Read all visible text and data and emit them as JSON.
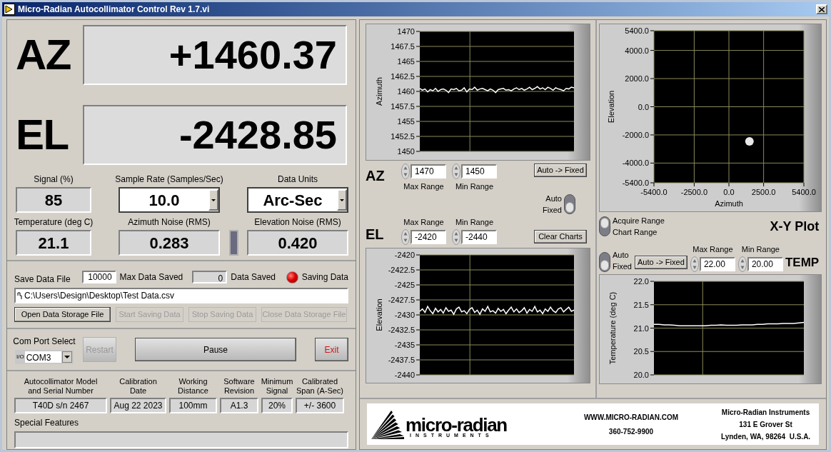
{
  "window": {
    "title": "Micro-Radian Autocollimator Control Rev 1.7.vi"
  },
  "readouts": [
    {
      "label": "AZ",
      "value": "+1460.37"
    },
    {
      "label": "EL",
      "value": "-2428.85"
    }
  ],
  "indicators": [
    {
      "label": "Signal (%)",
      "value": "85",
      "kind": "display"
    },
    {
      "label": "Sample Rate (Samples/Sec)",
      "value": "10.0",
      "kind": "dropdown"
    },
    {
      "label": "Data Units",
      "value": "Arc-Sec",
      "kind": "dropdown"
    },
    {
      "label": "Temperature (deg C)",
      "value": "21.1",
      "kind": "display"
    },
    {
      "label": "Azimuth Noise (RMS)",
      "value": "0.283",
      "kind": "display"
    },
    {
      "label": "Elevation Noise (RMS)",
      "value": "0.420",
      "kind": "display"
    }
  ],
  "save_data": {
    "title": "Save Data File",
    "max_saved": {
      "value": "10000",
      "label": "Max Data Saved"
    },
    "data_saved": {
      "value": "0",
      "label": "Data Saved"
    },
    "saving_led": {
      "label": "Saving Data",
      "on": true
    },
    "path": "C:\\Users\\Design\\Desktop\\Test Data.csv",
    "buttons": [
      {
        "label": "Open Data Storage File",
        "disabled": false
      },
      {
        "label": "Start Saving Data",
        "disabled": true
      },
      {
        "label": "Stop Saving Data",
        "disabled": true
      },
      {
        "label": "Close Data Storage File",
        "disabled": true
      }
    ]
  },
  "com_port": {
    "label": "Com Port Select",
    "io_symbol": "I/O",
    "value": "COM3"
  },
  "control_buttons": [
    {
      "label": "Restart",
      "kind": "small",
      "disabled": true
    },
    {
      "label": "Pause",
      "kind": "wide",
      "disabled": false
    },
    {
      "label": "Exit",
      "kind": "exit",
      "disabled": false
    }
  ],
  "info": {
    "columns": [
      {
        "label": "Autocollimator Model\nand Serial Number",
        "value": "T40D s/n 2467"
      },
      {
        "label": "Calibration\nDate",
        "value": "Aug 22 2023"
      },
      {
        "label": "Working\nDistance",
        "value": "100mm"
      },
      {
        "label": "Software\nRevision",
        "value": "A1.3"
      },
      {
        "label": "Minimum\nSignal",
        "value": "20%"
      },
      {
        "label": "Calibrated\nSpan (A-Sec)",
        "value": "+/- 3600"
      }
    ],
    "special_features": {
      "label": "Special Features"
    }
  },
  "az": {
    "label": "AZ",
    "max_range": {
      "label": "Max Range",
      "value": "1470"
    },
    "min_range": {
      "label": "Min Range",
      "value": "1450"
    },
    "button": "Auto -> Fixed",
    "chart_data": {
      "type": "line",
      "grid": true,
      "ylabel": "Azimuth",
      "ylim": [
        1450,
        1470
      ],
      "yticks": [
        1470,
        1467.5,
        1465,
        1462.5,
        1460,
        1457.5,
        1455,
        1452.5,
        1450
      ],
      "series": [
        {
          "color": "#ffffff",
          "values": [
            1460.5,
            1460.2,
            1460.4,
            1459.9,
            1460.3,
            1460.1,
            1460.5,
            1460.0,
            1460.3,
            1460.4,
            1460.2,
            1459.8,
            1460.4,
            1460.3,
            1460.5,
            1460.1,
            1460.2,
            1460.6,
            1459.9,
            1460.4,
            1460.3,
            1460.7,
            1460.2,
            1460.4,
            1460.5,
            1460.3,
            1460.1,
            1460.4,
            1460.2,
            1459.8,
            1460.3,
            1460.4,
            1460.5,
            1460.2,
            1460.3,
            1460.1,
            1460.4,
            1460.6,
            1460.3,
            1460.5,
            1460.2,
            1460.4,
            1460.7,
            1460.3,
            1460.5,
            1460.8,
            1460.4,
            1460.6,
            1460.3,
            1460.7,
            1460.5,
            1460.2,
            1460.6,
            1460.4,
            1460.3,
            1460.1,
            1460.5,
            1460.4,
            1460.7,
            1460.6
          ]
        }
      ]
    }
  },
  "auto_toggle": {
    "labels": [
      "Auto",
      "Fixed"
    ],
    "auto": false
  },
  "el": {
    "label": "EL",
    "max_range": {
      "label": "Max Range",
      "value": "-2420"
    },
    "min_range": {
      "label": "Min Range",
      "value": "-2440"
    },
    "button": "Clear Charts",
    "chart_data": {
      "type": "line",
      "grid": true,
      "ylabel": "Elevation",
      "ylim": [
        -2440,
        -2420
      ],
      "yticks": [
        -2420,
        -2422.5,
        -2425,
        -2427.5,
        -2430,
        -2432.5,
        -2435,
        -2437.5,
        -2440
      ],
      "series": [
        {
          "color": "#ffffff",
          "values": [
            -2429.4,
            -2429.0,
            -2429.6,
            -2428.6,
            -2429.3,
            -2429.8,
            -2428.9,
            -2429.5,
            -2429.1,
            -2429.7,
            -2428.8,
            -2429.4,
            -2429.2,
            -2429.9,
            -2429.0,
            -2428.7,
            -2429.5,
            -2429.3,
            -2429.8,
            -2429.1,
            -2428.8,
            -2429.6,
            -2429.2,
            -2429.9,
            -2429.0,
            -2429.4,
            -2428.6,
            -2429.5,
            -2429.3,
            -2429.7,
            -2428.9,
            -2429.4,
            -2429.1,
            -2429.8,
            -2429.2,
            -2428.7,
            -2429.5,
            -2429.0,
            -2429.6,
            -2429.3,
            -2428.8,
            -2429.7,
            -2429.1,
            -2429.4,
            -2428.6,
            -2429.5,
            -2429.2,
            -2429.8,
            -2429.0,
            -2429.4,
            -2428.7,
            -2429.3,
            -2429.6,
            -2429.0,
            -2428.8,
            -2429.5,
            -2429.1,
            -2428.7,
            -2429.4,
            -2429.2
          ]
        }
      ]
    }
  },
  "xy_plot": {
    "title": "X-Y Plot",
    "range_switch": {
      "labels": [
        "Acquire Range",
        "Chart Range"
      ],
      "acquire": true
    },
    "chart_data": {
      "type": "scatter",
      "grid": true,
      "xlabel": "Azimuth",
      "ylabel": "Elevation",
      "xlim": [
        -5400,
        5400
      ],
      "ylim": [
        -5400,
        5400
      ],
      "xticks": [
        {
          "value": -5400,
          "label": "-5400.0"
        },
        {
          "value": -2500,
          "label": "-2500.0"
        },
        {
          "value": 0,
          "label": "0.0"
        },
        {
          "value": 2500,
          "label": "2500.0"
        },
        {
          "value": 5400,
          "label": "5400.0"
        }
      ],
      "yticks": [
        {
          "value": 5400,
          "label": "5400.0"
        },
        {
          "value": 4000,
          "label": "4000.0"
        },
        {
          "value": 2000,
          "label": "2000.0"
        },
        {
          "value": 0,
          "label": "0.0"
        },
        {
          "value": -2000,
          "label": "-2000.0"
        },
        {
          "value": -4000,
          "label": "-4000.0"
        },
        {
          "value": -5400,
          "label": "-5400.0"
        }
      ],
      "x": [
        1480
      ],
      "series": [
        {
          "color": "#e8e8e8",
          "values": [
            -2460
          ]
        }
      ]
    }
  },
  "temp": {
    "title": "TEMP",
    "toggle": {
      "labels": [
        "Auto",
        "Fixed"
      ],
      "auto": false
    },
    "button": "Auto -> Fixed",
    "max_range": {
      "label": "Max Range",
      "value": "22.00"
    },
    "min_range": {
      "label": "Min Range",
      "value": "20.00"
    },
    "chart_data": {
      "type": "line",
      "grid": true,
      "ylabel": "Temperature (deg C)",
      "ylim": [
        20,
        22
      ],
      "yticks": [
        {
          "value": 22,
          "label": "22.0"
        },
        {
          "value": 21.5,
          "label": "21.5"
        },
        {
          "value": 21,
          "label": "21.0"
        },
        {
          "value": 20.5,
          "label": "20.5"
        },
        {
          "value": 20,
          "label": "20.0"
        }
      ],
      "series": [
        {
          "color": "#ffffff",
          "values": [
            21.08,
            21.08,
            21.07,
            21.07,
            21.06,
            21.05,
            21.05,
            21.05,
            21.05,
            21.05,
            21.05,
            21.06,
            21.06,
            21.07,
            21.06,
            21.06,
            21.06,
            21.07,
            21.07,
            21.07,
            21.08,
            21.08,
            21.09,
            21.09,
            21.09,
            21.1,
            21.1,
            21.1,
            21.11,
            21.12
          ]
        }
      ]
    }
  },
  "footer": {
    "logo_text": "micro-radian",
    "logo_subtext": "INSTRUMENTS",
    "website": "WWW.MICRO-RADIAN.COM",
    "phone": "360-752-9900",
    "address": [
      "Micro-Radian Instruments",
      "131 E Grover St",
      "Lynden, WA, 98264  U.S.A."
    ]
  }
}
